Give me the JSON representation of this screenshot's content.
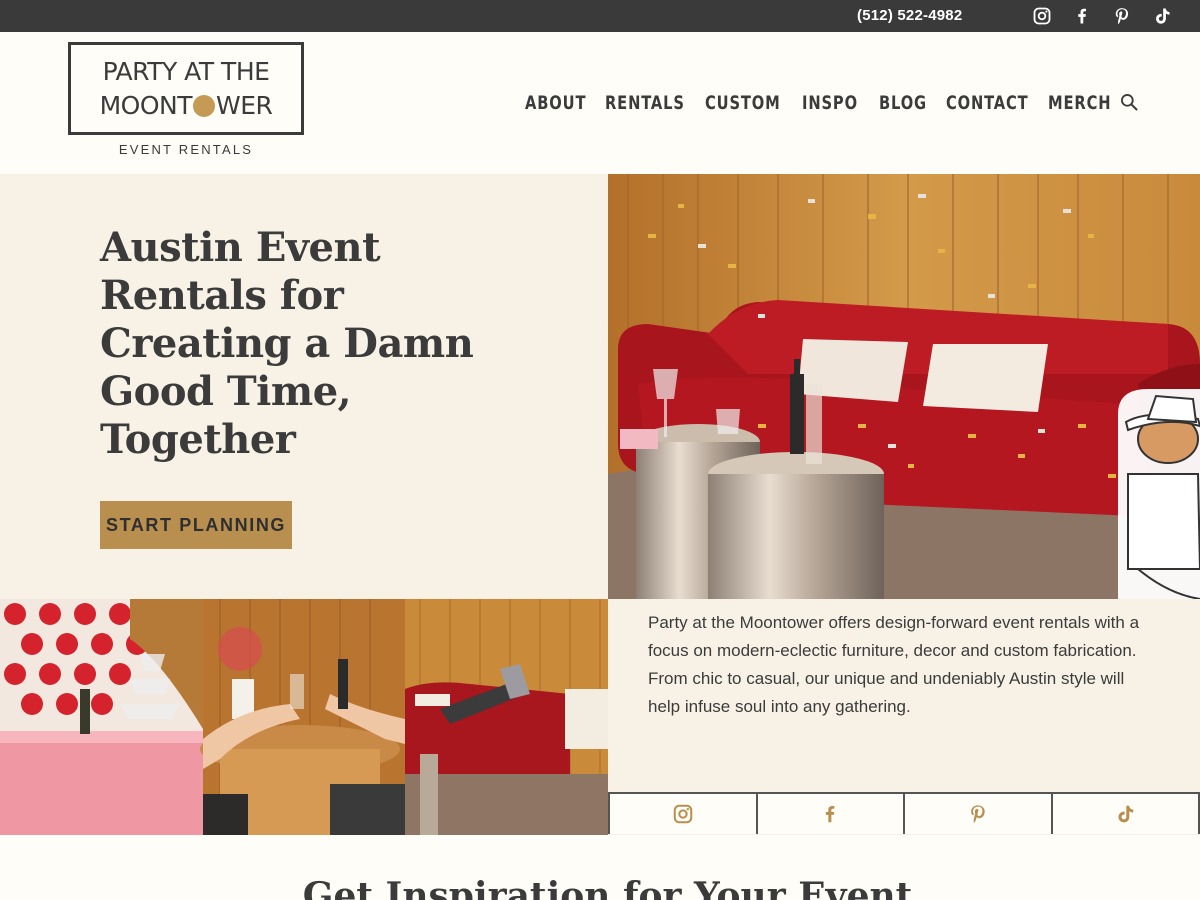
{
  "topbar": {
    "phone": "(512) 522-4982",
    "icons": [
      "instagram-icon",
      "facebook-icon",
      "pinterest-icon",
      "tiktok-icon"
    ],
    "background": "#3a3a3a"
  },
  "logo": {
    "line1": "PARTY AT THE",
    "line2_before": "MOONT",
    "line2_after": "WER",
    "subtitle": "EVENT RENTALS"
  },
  "nav": {
    "items": [
      "ABOUT",
      "RENTALS",
      "CUSTOM",
      "INSPO",
      "BLOG",
      "CONTACT",
      "MERCH"
    ],
    "search_icon": "search-icon"
  },
  "hero": {
    "title": "Austin Event Rentals for Creating a Damn Good Time, Together",
    "cta": "START PLANNING",
    "accent": "#b98f4f"
  },
  "about": {
    "text": "Party at the Moontower offers design-forward event rentals with a focus on modern-eclectic furniture, decor and custom fabrication. From chic to casual, our unique and undeniably Austin style will help infuse soul into any gathering."
  },
  "social_row": [
    "instagram-icon",
    "facebook-icon",
    "pinterest-icon",
    "tiktok-icon"
  ],
  "inspiration": {
    "title": "Get Inspiration for Your Event"
  },
  "colors": {
    "brand_gold": "#b98f4f",
    "text_dark": "#3b3b3b",
    "cream": "#f8f2e6"
  }
}
